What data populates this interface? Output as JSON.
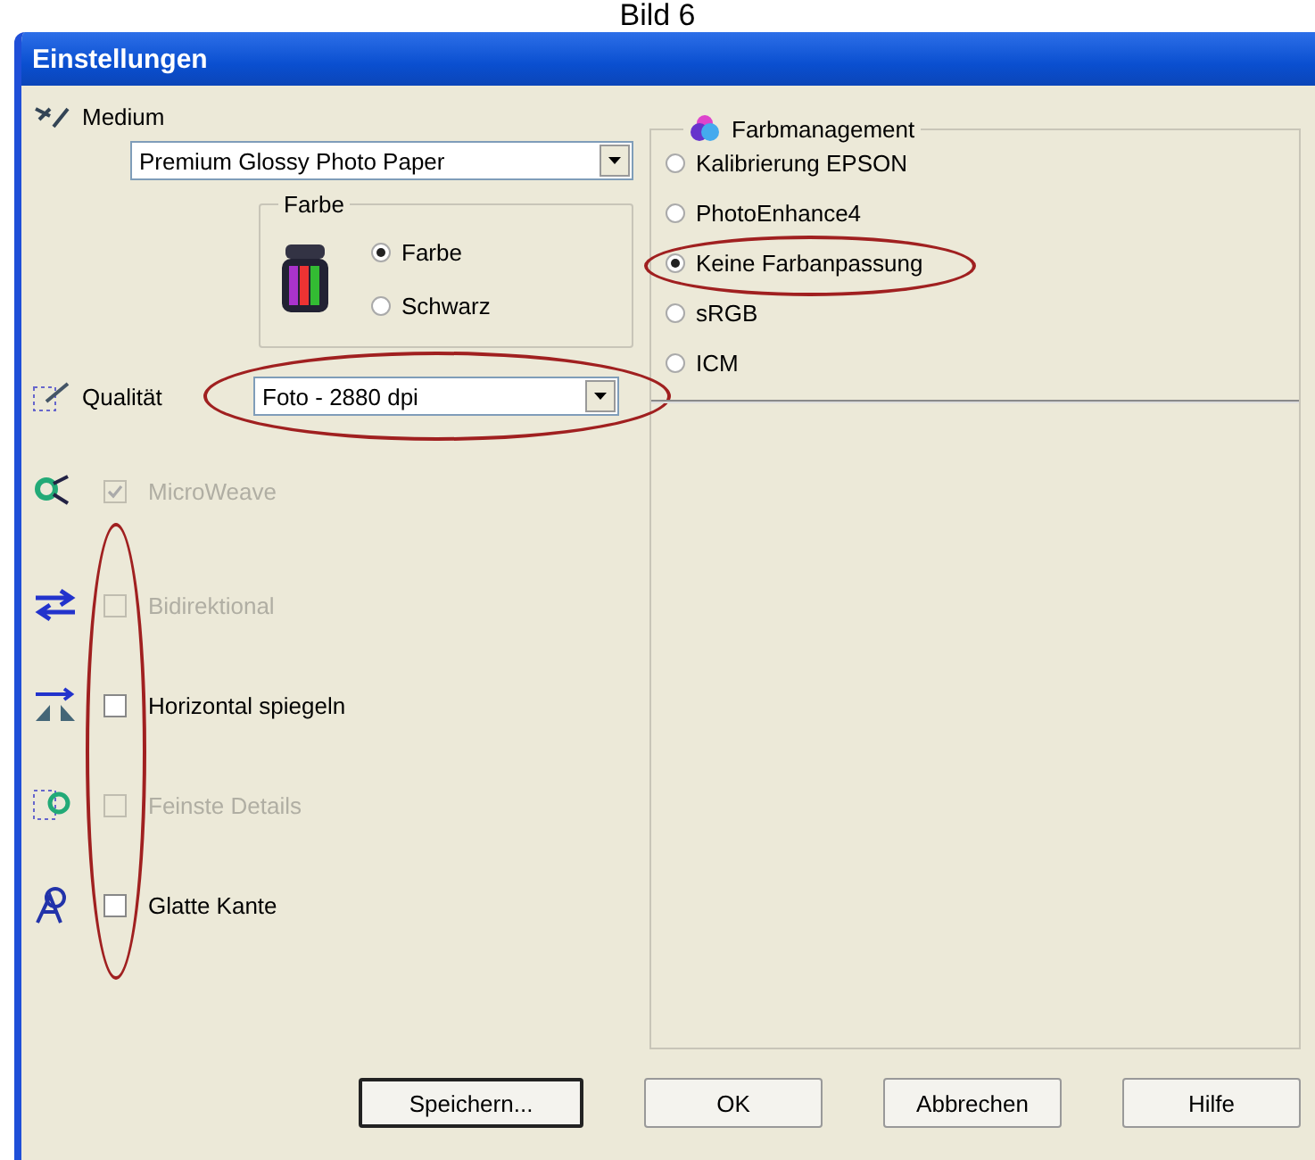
{
  "caption": "Bild 6",
  "window": {
    "title": "Einstellungen"
  },
  "medium": {
    "label": "Medium",
    "value": "Premium Glossy Photo Paper"
  },
  "color_group": {
    "title": "Farbe",
    "options": [
      {
        "label": "Farbe",
        "selected": true
      },
      {
        "label": "Schwarz",
        "selected": false
      }
    ]
  },
  "quality": {
    "label": "Qualität",
    "value": "Foto - 2880 dpi",
    "circled": true
  },
  "options": [
    {
      "label": "MicroWeave",
      "checked": true,
      "disabled": true,
      "circled": false
    },
    {
      "label": "Bidirektional",
      "checked": false,
      "disabled": true,
      "circled": true
    },
    {
      "label": "Horizontal spiegeln",
      "checked": false,
      "disabled": false,
      "circled": true
    },
    {
      "label": "Feinste Details",
      "checked": false,
      "disabled": true,
      "circled": true
    },
    {
      "label": "Glatte Kante",
      "checked": false,
      "disabled": false,
      "circled": true
    }
  ],
  "color_management": {
    "title": "Farbmanagement",
    "options": [
      {
        "label": "Kalibrierung EPSON",
        "selected": false,
        "circled": false
      },
      {
        "label": "PhotoEnhance4",
        "selected": false,
        "circled": false
      },
      {
        "label": "Keine Farbanpassung",
        "selected": true,
        "circled": true
      },
      {
        "label": "sRGB",
        "selected": false,
        "circled": false
      },
      {
        "label": "ICM",
        "selected": false,
        "circled": false
      }
    ]
  },
  "buttons": [
    {
      "label": "Speichern...",
      "default": true
    },
    {
      "label": "OK",
      "default": false
    },
    {
      "label": "Abbrechen",
      "default": false
    },
    {
      "label": "Hilfe",
      "default": false
    }
  ]
}
